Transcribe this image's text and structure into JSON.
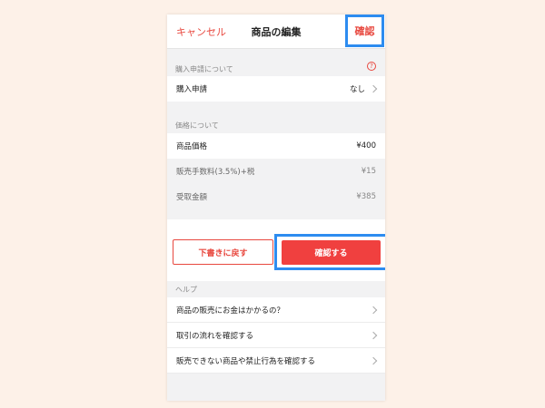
{
  "header": {
    "cancel_label": "キャンセル",
    "title": "商品の編集",
    "confirm_label": "確認"
  },
  "purchase_section": {
    "heading": "購入申請について",
    "row_label": "購入申請",
    "row_value": "なし"
  },
  "price_section": {
    "heading": "価格について",
    "price_label": "商品価格",
    "price_value": "¥400",
    "fee_label": "販売手数料(3.5%)+税",
    "fee_value": "¥15",
    "receive_label": "受取金額",
    "receive_value": "¥385"
  },
  "actions": {
    "draft_label": "下書きに戻す",
    "submit_label": "確認する"
  },
  "help_section": {
    "heading": "ヘルプ",
    "items": [
      "商品の販売にお金はかかるの？",
      "取引の流れを確認する",
      "販売できない商品や禁止行為を確認する"
    ]
  },
  "colors": {
    "accent": "#e8483f",
    "highlight": "#2d8cf0",
    "background": "#fdf1e8"
  }
}
